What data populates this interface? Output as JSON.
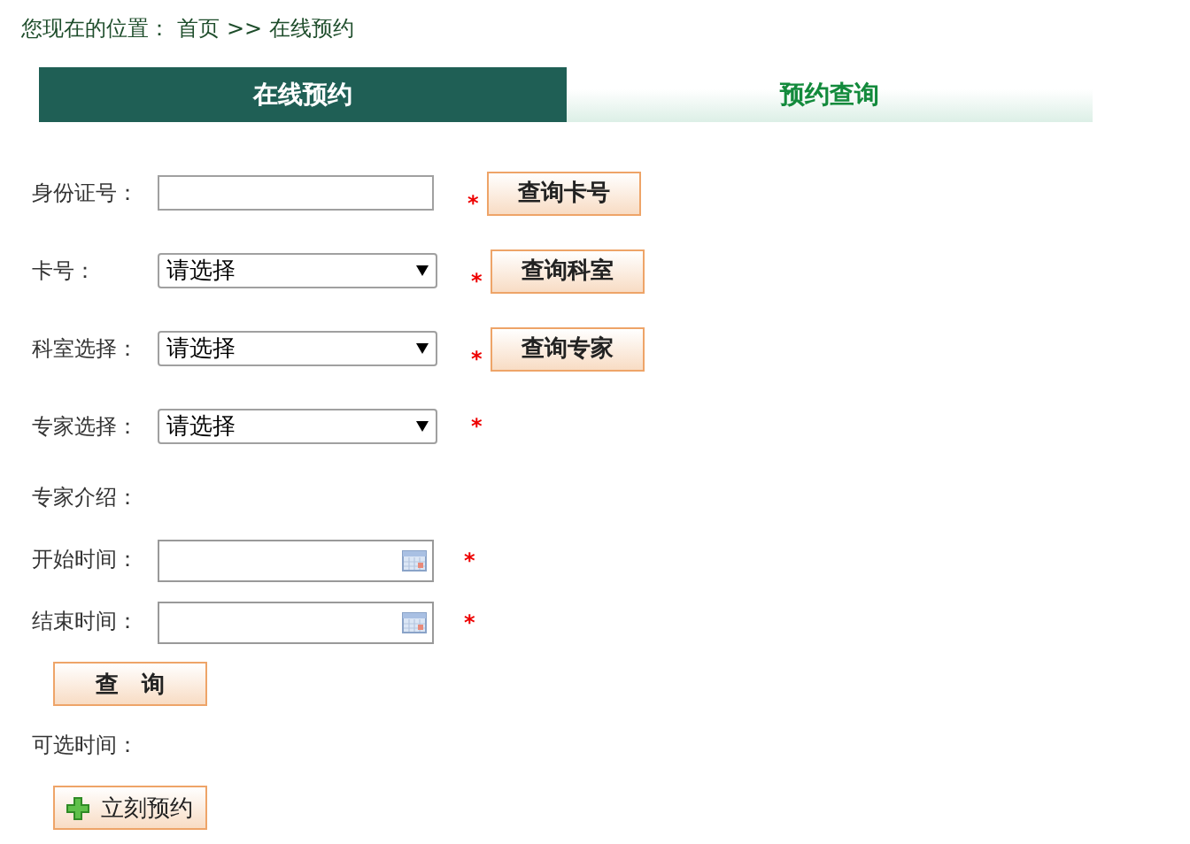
{
  "breadcrumb": {
    "prefix": "您现在的位置：",
    "home": "首页",
    "separator": ">>",
    "current": "在线预约"
  },
  "tabs": [
    {
      "label": "在线预约",
      "selected": true
    },
    {
      "label": "预约查询",
      "selected": false
    }
  ],
  "form": [
    {
      "kind": "text",
      "label": "身份证号：",
      "required": true,
      "button": "查询卡号"
    },
    {
      "kind": "select",
      "label": "卡号：",
      "value": "请选择",
      "required": true,
      "button": "查询科室"
    },
    {
      "kind": "select",
      "label": "科室选择：",
      "value": "请选择",
      "required": true,
      "button": "查询专家"
    },
    {
      "kind": "select",
      "label": "专家选择：",
      "value": "请选择",
      "required": true
    },
    {
      "kind": "info",
      "label": "专家介绍："
    },
    {
      "kind": "date",
      "label": "开始时间：",
      "required": true
    },
    {
      "kind": "date",
      "label": "结束时间：",
      "required": true
    }
  ],
  "query_button": "查　询",
  "available_label": "可选时间：",
  "book_button": "立刻预约",
  "required_mark": "*"
}
